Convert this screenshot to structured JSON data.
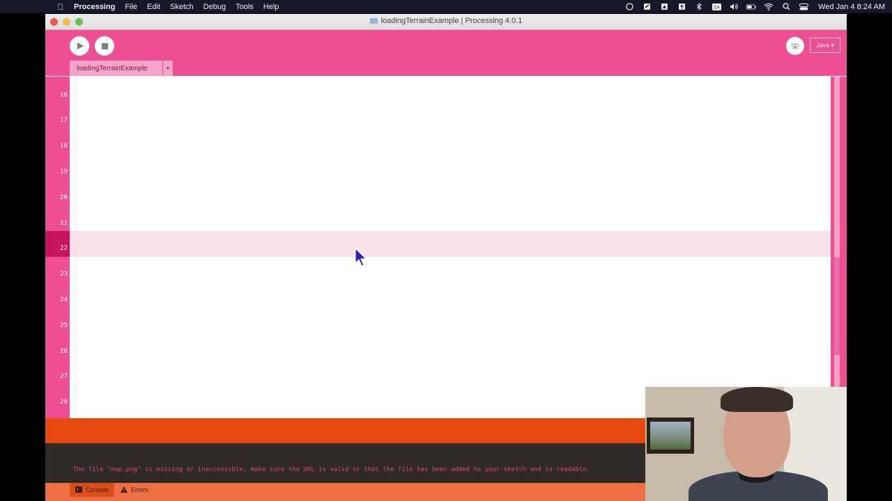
{
  "menubar": {
    "app_name": "Processing",
    "items": [
      "File",
      "Edit",
      "Sketch",
      "Debug",
      "Tools",
      "Help"
    ],
    "status_icons": [
      "creative-cloud-icon",
      "sync-icon",
      "drive-icon",
      "accessibility-icon",
      "bluetooth-icon",
      "input-source-icon",
      "volume-icon",
      "battery-icon",
      "wifi-icon",
      "spotlight-icon",
      "control-center-icon"
    ],
    "input_source": "CA",
    "clock": "Wed Jan 4  8:24 AM"
  },
  "window": {
    "title": "loadingTerrainExample | Processing 4.0.1"
  },
  "toolbar": {
    "mode_label": "Java ▾",
    "tab_label": "loadingTerrainExample",
    "tab_arrow": "▼"
  },
  "editor": {
    "line_numbers": [
      "16",
      "17",
      "18",
      "19",
      "20",
      "21",
      "22",
      "23",
      "24",
      "25",
      "26",
      "27",
      "28"
    ],
    "highlighted_line": "22"
  },
  "console": {
    "message": "The file \"map.png\" is missing or inaccessible, make sure the URL is valid or that the file has been added to your sketch and is readable.",
    "console_tab": "Console",
    "errors_tab": "Errors"
  },
  "colors": {
    "accent": "#ee4e93",
    "highlight_line": "#fbe1ec",
    "console_strip": "#e8490f",
    "console_text": "#e0457a"
  }
}
